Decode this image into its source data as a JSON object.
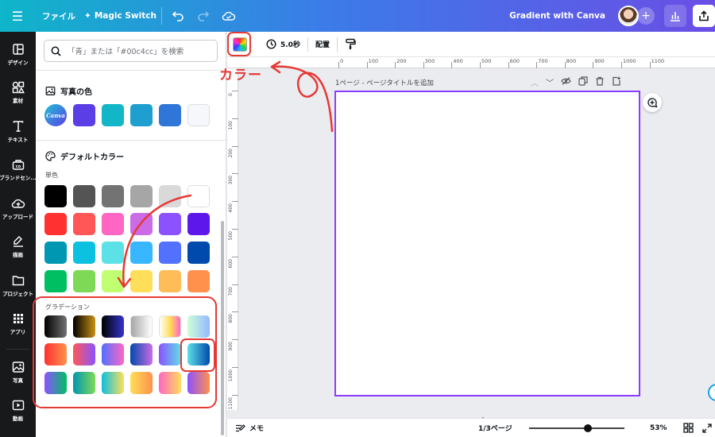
{
  "topbar": {
    "file_label": "ファイル",
    "magic_label": "Magic Switch",
    "doc_title": "Gradient with Canva"
  },
  "sidebar": {
    "items": [
      {
        "label": "デザイン",
        "icon": "layout-icon"
      },
      {
        "label": "素材",
        "icon": "elements-icon"
      },
      {
        "label": "テキスト",
        "icon": "text-icon"
      },
      {
        "label": "ブランドセン...",
        "icon": "brand-icon"
      },
      {
        "label": "アップロード",
        "icon": "upload-icon"
      },
      {
        "label": "描画",
        "icon": "draw-icon"
      },
      {
        "label": "プロジェクト",
        "icon": "folder-icon"
      },
      {
        "label": "アプリ",
        "icon": "apps-icon"
      },
      {
        "label": "写真",
        "icon": "photo-icon"
      },
      {
        "label": "動画",
        "icon": "video-icon"
      }
    ]
  },
  "panel": {
    "search_placeholder": "「青」または「#00c4cc」を検索",
    "photo_colors_title": "写真の色",
    "canva_logo_text": "Canva",
    "photo_colors": [
      "#5b3ee6",
      "#12b6c6",
      "#1e9fd0",
      "#2f76d8",
      "#f5f7fa"
    ],
    "default_colors_title": "デフォルトカラー",
    "solid_label": "単色",
    "solid_colors": [
      [
        "#000000",
        "#545454",
        "#737373",
        "#a6a6a6",
        "#d9d9d9",
        "#ffffff"
      ],
      [
        "#ff3131",
        "#ff5757",
        "#ff66c4",
        "#cb6ce6",
        "#8c52ff",
        "#5e17eb"
      ],
      [
        "#0097b2",
        "#0cc0df",
        "#5ce1e6",
        "#38b6ff",
        "#5271ff",
        "#004aad"
      ],
      [
        "#00bf63",
        "#7ed957",
        "#c1ff72",
        "#ffde59",
        "#ffbd59",
        "#ff914d"
      ]
    ],
    "gradient_label": "グラデーション",
    "gradients": [
      [
        "linear-gradient(90deg,#000000,#737373)",
        "linear-gradient(90deg,#000000,#c89116)",
        "linear-gradient(90deg,#000000,#3533cd)",
        "linear-gradient(90deg,#a6a6a6,#ffffff)",
        "linear-gradient(90deg,#ffffff,#ffde59,#ff66c4)",
        "linear-gradient(90deg,#cdffd8,#94b9ff)"
      ],
      [
        "linear-gradient(90deg,#ff3131,#ff914d)",
        "linear-gradient(90deg,#ff5757,#8c52ff)",
        "linear-gradient(90deg,#5170ff,#ff66c4)",
        "linear-gradient(90deg,#004aad,#cb6ce6)",
        "linear-gradient(90deg,#8c52ff,#5ce1e6)",
        "linear-gradient(90deg,#5de0e6,#004aad)"
      ],
      [
        "linear-gradient(90deg,#8c52ff,#00bf63)",
        "linear-gradient(90deg,#0097b2,#7ed957)",
        "linear-gradient(90deg,#0cc0df,#ffde59)",
        "linear-gradient(90deg,#ffde59,#ff914d)",
        "linear-gradient(90deg,#ff66c4,#ffde59)",
        "linear-gradient(90deg,#8c52ff,#ff914d)"
      ]
    ]
  },
  "toolbar": {
    "timing_label": "5.0秒",
    "arrange_label": "配置"
  },
  "ruler": {
    "h_ticks": [
      "0",
      "100",
      "200",
      "300",
      "400",
      "500",
      "600",
      "700",
      "800",
      "900",
      "1000",
      "1100"
    ],
    "v_ticks": [
      "0",
      "100",
      "200",
      "300",
      "400",
      "500",
      "600",
      "700",
      "800",
      "900",
      "1000",
      "1100"
    ]
  },
  "canvas": {
    "page_label": "1ページ - ページタイトルを追加"
  },
  "footer": {
    "memo_label": "メモ",
    "pages_label": "1/3ページ",
    "zoom_label": "53%",
    "zoom_level": 0.53
  },
  "annotation": {
    "color_label": "カラー",
    "accent": "#e53935"
  }
}
